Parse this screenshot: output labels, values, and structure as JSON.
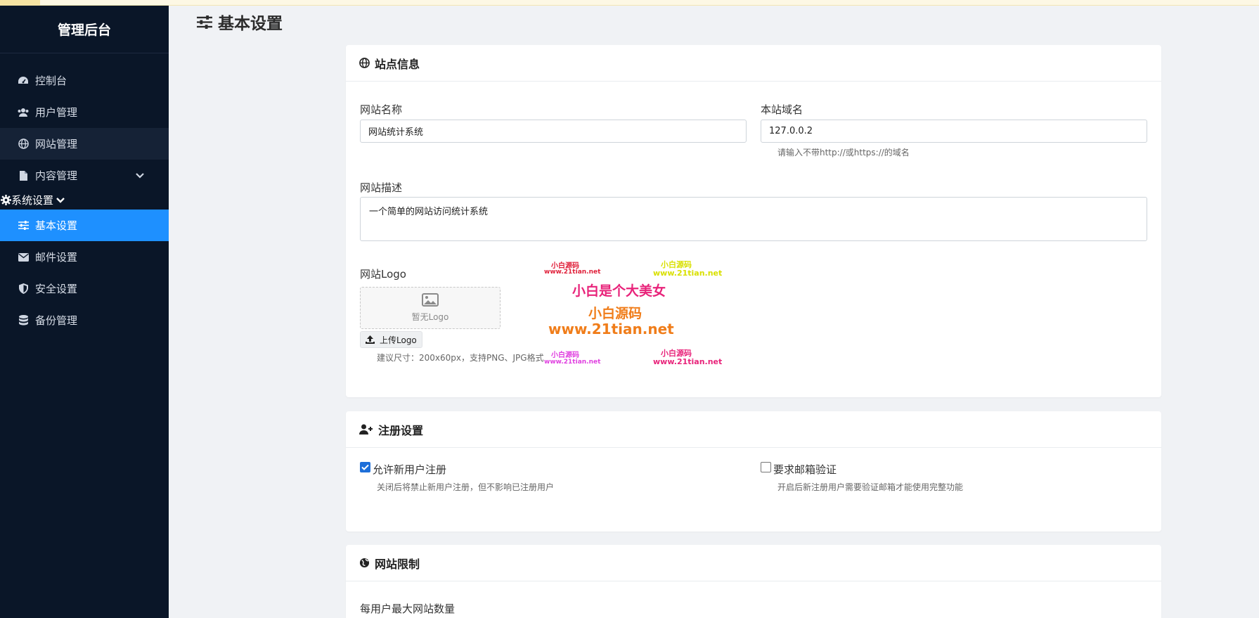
{
  "brand": "管理后台",
  "sidebar": {
    "items": [
      {
        "label": "控制台",
        "icon": "dashboard-icon"
      },
      {
        "label": "用户管理",
        "icon": "users-icon"
      },
      {
        "label": "网站管理",
        "icon": "globe-icon"
      },
      {
        "label": "内容管理",
        "icon": "file-icon"
      }
    ],
    "group": {
      "label": "系统设置",
      "icon": "cog-icon"
    },
    "sub_items": [
      {
        "label": "基本设置",
        "icon": "sliders-icon"
      },
      {
        "label": "邮件设置",
        "icon": "envelope-icon"
      },
      {
        "label": "安全设置",
        "icon": "shield-icon"
      },
      {
        "label": "备份管理",
        "icon": "database-icon"
      }
    ]
  },
  "page": {
    "title": "基本设置"
  },
  "site_info": {
    "title": "站点信息",
    "name_label": "网站名称",
    "name_value": "网站统计系统",
    "domain_label": "本站域名",
    "domain_value": "127.0.0.2",
    "domain_hint": "请输入不带http://或https://的域名",
    "desc_label": "网站描述",
    "desc_value": "一个简单的网站访问统计系统",
    "logo_label": "网站Logo",
    "logo_placeholder": "暂无Logo",
    "upload_label": "上传Logo",
    "logo_hint": "建议尺寸：200x60px，支持PNG、JPG格式"
  },
  "register": {
    "title": "注册设置",
    "allow_label": "允许新用户注册",
    "allow_checked": true,
    "allow_hint": "关闭后将禁止新用户注册，但不影响已注册用户",
    "verify_label": "要求邮箱验证",
    "verify_checked": false,
    "verify_hint": "开启后新注册用户需要验证邮箱才能使用完整功能"
  },
  "limits": {
    "title": "网站限制",
    "max_sites_label": "每用户最大网站数量"
  },
  "watermark": {
    "w1": "小白源码",
    "w1_url": "www.21tian.net",
    "w2": "小白源码",
    "w2_url": "www.21tian.net",
    "w3": "小白是个大美女",
    "w4": "小白源码",
    "w4_url": "www.21tian.net",
    "w5": "小白源码",
    "w5_url": "www.21tian.net",
    "w6": "小白源码",
    "w6_url": "www.21tian.net"
  },
  "colors": {
    "sidebar_bg": "#0a1628",
    "active": "#1e90ff",
    "checkbox": "#1e6fd9"
  }
}
